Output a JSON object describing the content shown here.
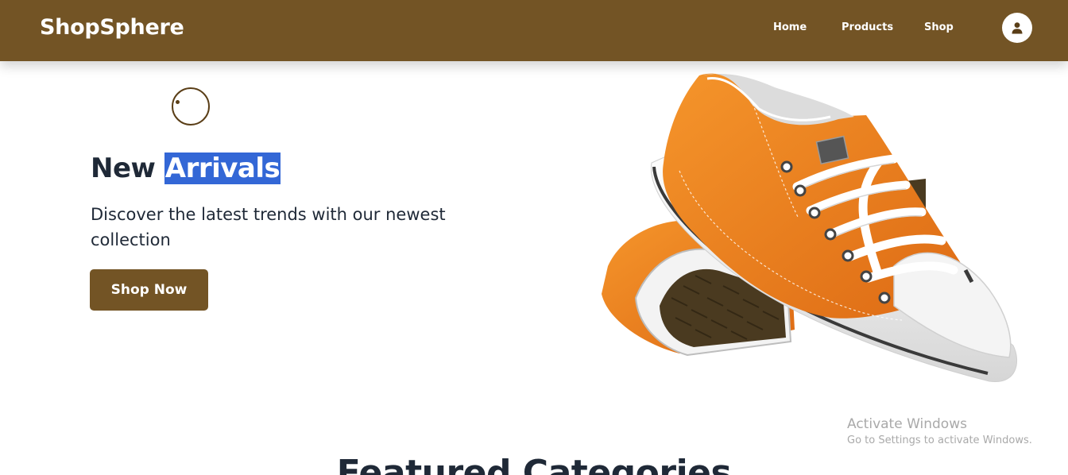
{
  "navbar": {
    "brand": "ShopSphere",
    "links": [
      {
        "label": "Home"
      },
      {
        "label": "Products"
      },
      {
        "label": "Shop"
      }
    ],
    "avatar_icon": "user-icon",
    "background": "#735425"
  },
  "hero": {
    "title_part1": "New ",
    "title_highlight": "Arrivals",
    "subtitle": "Discover the latest trends with our newest collection",
    "cta_label": "Shop Now",
    "image_icon": "orange-sneakers-image",
    "loader_icon": "loading-ring-icon"
  },
  "featured": {
    "title": "Featured Categories"
  },
  "watermark": {
    "title": "Activate Windows",
    "subtitle": "Go to Settings to activate Windows."
  },
  "colors": {
    "brand": "#735425",
    "text_dark": "#1f2937",
    "selection_highlight": "#3367d6",
    "sneaker_orange": "#ea7d1e"
  }
}
